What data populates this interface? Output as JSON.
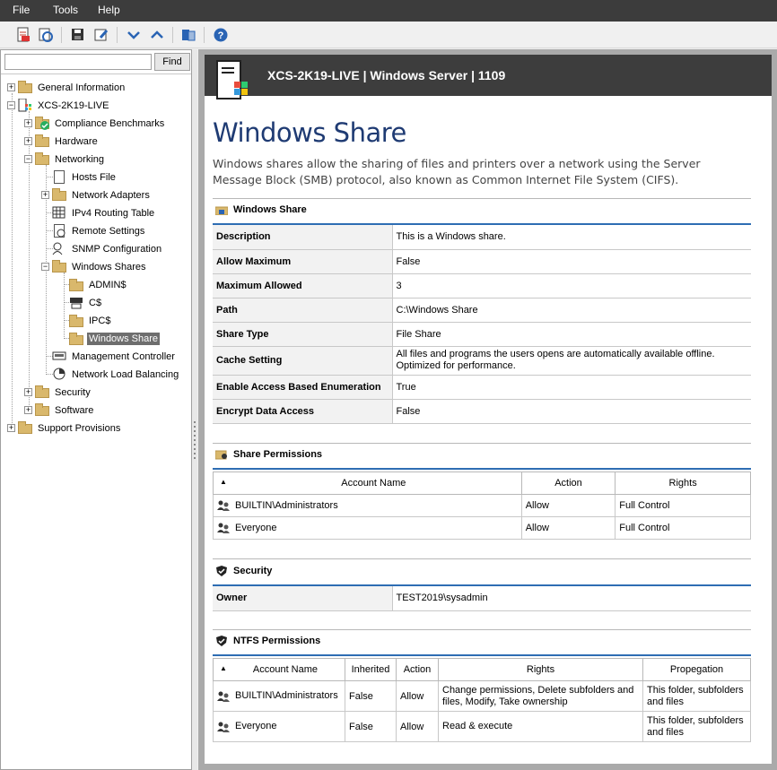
{
  "menu": [
    "File",
    "Tools",
    "Help"
  ],
  "toolbar": {
    "icons": [
      "pdf-export-icon",
      "refresh-icon",
      "save-icon",
      "edit-icon",
      "collapse-icon",
      "expand-icon",
      "database-icon",
      "help-icon"
    ]
  },
  "tree": {
    "search_placeholder": "",
    "find_label": "Find",
    "items": [
      {
        "label": "General Information"
      },
      {
        "label": "XCS-2K19-LIVE"
      },
      {
        "label": "Compliance Benchmarks"
      },
      {
        "label": "Hardware"
      },
      {
        "label": "Networking"
      },
      {
        "label": "Hosts File"
      },
      {
        "label": "Network Adapters"
      },
      {
        "label": "IPv4 Routing Table"
      },
      {
        "label": "Remote Settings"
      },
      {
        "label": "SNMP Configuration"
      },
      {
        "label": "Windows Shares"
      },
      {
        "label": "ADMIN$"
      },
      {
        "label": "C$"
      },
      {
        "label": "IPC$"
      },
      {
        "label": "Windows Share"
      },
      {
        "label": "Management Controller"
      },
      {
        "label": "Network Load Balancing"
      },
      {
        "label": "Security"
      },
      {
        "label": "Software"
      },
      {
        "label": "Support Provisions"
      }
    ]
  },
  "header": {
    "title": "XCS-2K19-LIVE | Windows Server | 1109"
  },
  "page": {
    "title": "Windows Share",
    "description": "Windows shares allow the sharing of files and printers over a network using the Server Message Block (SMB) protocol, also known as Common Internet File System (CIFS)."
  },
  "share": {
    "heading": "Windows Share",
    "rows": [
      {
        "k": "Description",
        "v": "This is a Windows share."
      },
      {
        "k": "Allow Maximum",
        "v": "False"
      },
      {
        "k": "Maximum Allowed",
        "v": "3"
      },
      {
        "k": "Path",
        "v": "C:\\Windows Share"
      },
      {
        "k": "Share Type",
        "v": "File Share"
      },
      {
        "k": "Cache Setting",
        "v": "All files and programs the users opens are automatically available offline. Optimized for performance."
      },
      {
        "k": "Enable Access Based Enumeration",
        "v": "True"
      },
      {
        "k": "Encrypt Data Access",
        "v": "False"
      }
    ]
  },
  "share_permissions": {
    "heading": "Share Permissions",
    "columns": [
      "Account Name",
      "Action",
      "Rights"
    ],
    "rows": [
      {
        "account": "BUILTIN\\Administrators",
        "action": "Allow",
        "rights": "Full Control"
      },
      {
        "account": "Everyone",
        "action": "Allow",
        "rights": "Full Control"
      }
    ]
  },
  "security": {
    "heading": "Security",
    "owner_label": "Owner",
    "owner": "TEST2019\\sysadmin"
  },
  "ntfs": {
    "heading": "NTFS Permissions",
    "columns": [
      "Account Name",
      "Inherited",
      "Action",
      "Rights",
      "Propegation"
    ],
    "rows": [
      {
        "account": "BUILTIN\\Administrators",
        "inherited": "False",
        "action": "Allow",
        "rights": "Change permissions, Delete subfolders and files, Modify, Take ownership",
        "propagation": "This folder, subfolders and files"
      },
      {
        "account": "Everyone",
        "inherited": "False",
        "action": "Allow",
        "rights": "Read & execute",
        "propagation": "This folder, subfolders and files"
      }
    ]
  }
}
